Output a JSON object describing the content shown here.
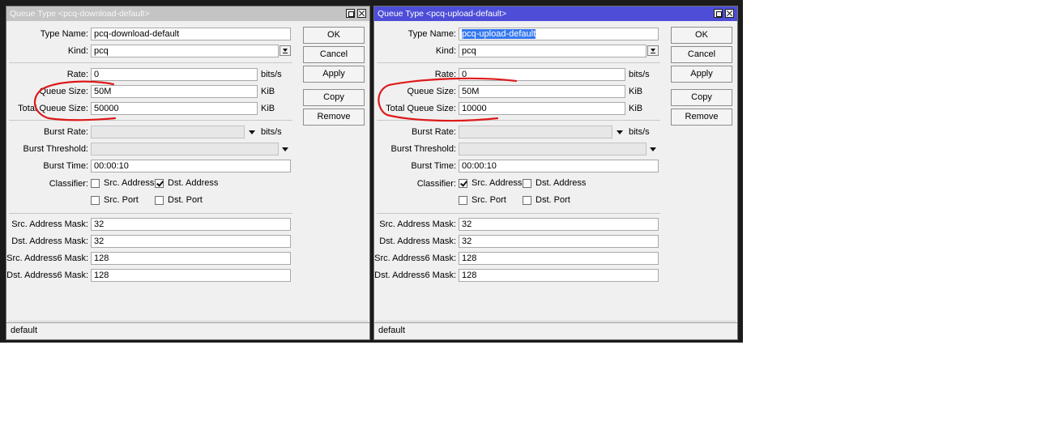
{
  "windows": [
    {
      "id": "download",
      "title": "Queue Type <pcq-download-default>",
      "type_name_label": "Type Name:",
      "type_name": "pcq-download-default",
      "kind_label": "Kind:",
      "kind": "pcq",
      "rate_label": "Rate:",
      "rate": "0",
      "rate_unit": "bits/s",
      "queue_size_label": "Queue Size:",
      "queue_size": "50M",
      "queue_size_unit": "KiB",
      "total_queue_size_label": "Total Queue Size:",
      "total_queue_size": "50000",
      "total_queue_size_unit": "KiB",
      "burst_rate_label": "Burst Rate:",
      "burst_rate": "",
      "burst_rate_unit": "bits/s",
      "burst_threshold_label": "Burst Threshold:",
      "burst_threshold": "",
      "burst_time_label": "Burst Time:",
      "burst_time": "00:00:10",
      "classifier_label": "Classifier:",
      "classifier": [
        {
          "label": "Src. Address",
          "checked": false
        },
        {
          "label": "Dst. Address",
          "checked": true
        },
        {
          "label": "Src. Port",
          "checked": false
        },
        {
          "label": "Dst. Port",
          "checked": false
        }
      ],
      "src_address_mask_label": "Src. Address Mask:",
      "src_address_mask": "32",
      "dst_address_mask_label": "Dst. Address Mask:",
      "dst_address_mask": "32",
      "src_address6_mask_label": "Src. Address6 Mask:",
      "src_address6_mask": "128",
      "dst_address6_mask_label": "Dst. Address6 Mask:",
      "dst_address6_mask": "128",
      "buttons": {
        "ok": "OK",
        "cancel": "Cancel",
        "apply": "Apply",
        "copy": "Copy",
        "remove": "Remove"
      },
      "status": "default",
      "active": false
    },
    {
      "id": "upload",
      "title": "Queue Type <pcq-upload-default>",
      "type_name_label": "Type Name:",
      "type_name": "pcq-upload-default",
      "kind_label": "Kind:",
      "kind": "pcq",
      "rate_label": "Rate:",
      "rate": "0",
      "rate_unit": "bits/s",
      "queue_size_label": "Queue Size:",
      "queue_size": "50M",
      "queue_size_unit": "KiB",
      "total_queue_size_label": "Total Queue Size:",
      "total_queue_size": "10000",
      "total_queue_size_unit": "KiB",
      "burst_rate_label": "Burst Rate:",
      "burst_rate": "",
      "burst_rate_unit": "bits/s",
      "burst_threshold_label": "Burst Threshold:",
      "burst_threshold": "",
      "burst_time_label": "Burst Time:",
      "burst_time": "00:00:10",
      "classifier_label": "Classifier:",
      "classifier": [
        {
          "label": "Src. Address",
          "checked": true
        },
        {
          "label": "Dst. Address",
          "checked": false
        },
        {
          "label": "Src. Port",
          "checked": false
        },
        {
          "label": "Dst. Port",
          "checked": false
        }
      ],
      "src_address_mask_label": "Src. Address Mask:",
      "src_address_mask": "32",
      "dst_address_mask_label": "Dst. Address Mask:",
      "dst_address_mask": "32",
      "src_address6_mask_label": "Src. Address6 Mask:",
      "src_address6_mask": "128",
      "dst_address6_mask_label": "Dst. Address6 Mask:",
      "dst_address6_mask": "128",
      "buttons": {
        "ok": "OK",
        "cancel": "Cancel",
        "apply": "Apply",
        "copy": "Copy",
        "remove": "Remove"
      },
      "status": "default",
      "active": true
    }
  ],
  "colors": {
    "active_titlebar": "#4d4dd8",
    "inactive_titlebar": "#c4c4c4",
    "annotation": "#dd1a1a",
    "selection": "#3377ee"
  },
  "icons": [
    "maximize-icon",
    "close-icon",
    "dropdown-arrow-icon",
    "checkbox-icon"
  ]
}
